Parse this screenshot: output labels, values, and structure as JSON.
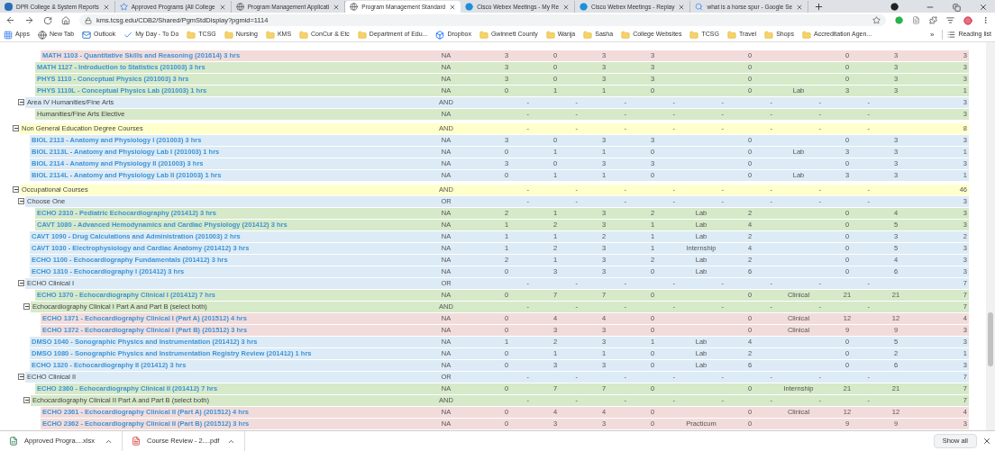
{
  "browser": {
    "tabs": [
      {
        "title": "DPR College & System Reports",
        "selected": false,
        "kind": "portal"
      },
      {
        "title": "Approved Programs (All College",
        "selected": false,
        "kind": "star"
      },
      {
        "title": "Program Management Applicati",
        "selected": false,
        "kind": "globe"
      },
      {
        "title": "Program Management Standard",
        "selected": true,
        "kind": "globe"
      },
      {
        "title": "Cisco Webex Meetings - My Re",
        "selected": false,
        "kind": "webex"
      },
      {
        "title": "Cisco Webex Meetings - Replay",
        "selected": false,
        "kind": "webex"
      },
      {
        "title": "what is a horse spur - Google Se",
        "selected": false,
        "kind": "search"
      }
    ],
    "address": "kms.tcsg.edu/CDB2/Shared/PgmStdDisplay?pgmid=1114",
    "bookmarks": [
      {
        "label": "Apps",
        "kind": "apps"
      },
      {
        "label": "New Tab",
        "kind": "site"
      },
      {
        "label": "Outlook",
        "kind": "mail"
      },
      {
        "label": "My Day - To Do",
        "kind": "check"
      },
      {
        "label": "TCSG",
        "kind": "folder"
      },
      {
        "label": "Nursing",
        "kind": "folder"
      },
      {
        "label": "KMS",
        "kind": "folder"
      },
      {
        "label": "ConCur & Etc",
        "kind": "folder"
      },
      {
        "label": "Department of Edu...",
        "kind": "folder"
      },
      {
        "label": "Dropbox",
        "kind": "box"
      },
      {
        "label": "Gwinnett County",
        "kind": "folder"
      },
      {
        "label": "Wanja",
        "kind": "folder"
      },
      {
        "label": "Sasha",
        "kind": "folder"
      },
      {
        "label": "College Websites",
        "kind": "folder"
      },
      {
        "label": "TCSG",
        "kind": "folder"
      },
      {
        "label": "Travel",
        "kind": "folder"
      },
      {
        "label": "Shops",
        "kind": "folder"
      },
      {
        "label": "Accreditation Agen...",
        "kind": "folder"
      }
    ],
    "overflow": "»",
    "reading_list": "Reading list"
  },
  "outline": [
    {
      "children": [
        {
          "children": [
            {
              "children": [
                {
                  "kind": "course",
                  "title": "MATH 1103 - Quantitative Skills and Reasoning (201614) 3 hrs",
                  "operator": "NA",
                  "color": "#f2dcdb",
                  "cells": [
                    "3",
                    "0",
                    "3",
                    "3",
                    null,
                    "0",
                    null,
                    "0",
                    "3",
                    "3"
                  ]
                }
              ]
            },
            {
              "kind": "course",
              "title": "MATH 1127 - Introduction to Statistics (201003) 3 hrs",
              "operator": "NA",
              "color": "#d6e9c9",
              "cells": [
                "3",
                "0",
                "3",
                "3",
                null,
                "0",
                null,
                "0",
                "3",
                "3"
              ]
            },
            {
              "kind": "course",
              "title": "PHYS 1110 - Conceptual Physics (201003) 3 hrs",
              "operator": "NA",
              "color": "#d6e9c9",
              "cells": [
                "3",
                "0",
                "3",
                "3",
                null,
                "0",
                null,
                "0",
                "3",
                "3"
              ]
            },
            {
              "kind": "course",
              "title": "PHYS 1110L - Conceptual Physics Lab (201003) 1 hrs",
              "operator": "NA",
              "color": "#d6e9c9",
              "cells": [
                "0",
                "1",
                "1",
                "0",
                null,
                "0",
                "Lab",
                "3",
                "3",
                "1"
              ]
            }
          ]
        },
        {
          "kind": "group",
          "title": "Area IV Humanities/Fine Arts",
          "operator": "AND",
          "color": "#dcebf6",
          "expanded": true,
          "cells": [
            "-",
            "-",
            "-",
            "-",
            "-",
            "-",
            "-",
            "-",
            null,
            "3"
          ],
          "children": [
            {
              "kind": "elective",
              "title": "Humanities/Fine Arts Elective",
              "operator": "NA",
              "color": "#d6e9c9",
              "cells": [
                "-",
                "-",
                "-",
                "-",
                "-",
                "-",
                "-",
                "-",
                null,
                "3"
              ]
            }
          ]
        }
      ]
    },
    {
      "kind": "group",
      "title": "Non General Education Degree Courses",
      "operator": "AND",
      "color": "#ffffcc",
      "expanded": true,
      "cells": [
        "-",
        "-",
        "-",
        "-",
        "-",
        "-",
        "-",
        "-",
        null,
        "8"
      ],
      "children": [
        {
          "kind": "course",
          "title": "BIOL 2113 - Anatomy and Physiology I (201003) 3 hrs",
          "operator": "NA",
          "color": "#dcebf6",
          "cells": [
            "3",
            "0",
            "3",
            "3",
            null,
            "0",
            null,
            "0",
            "3",
            "3"
          ]
        },
        {
          "kind": "course",
          "title": "BIOL 2113L - Anatomy and Physiology Lab I (201003) 1 hrs",
          "operator": "NA",
          "color": "#dcebf6",
          "cells": [
            "0",
            "1",
            "1",
            "0",
            null,
            "0",
            "Lab",
            "3",
            "3",
            "1"
          ]
        },
        {
          "kind": "course",
          "title": "BIOL 2114 - Anatomy and Physiology II (201003) 3 hrs",
          "operator": "NA",
          "color": "#dcebf6",
          "cells": [
            "3",
            "0",
            "3",
            "3",
            null,
            "0",
            null,
            "0",
            "3",
            "3"
          ]
        },
        {
          "kind": "course",
          "title": "BIOL 2114L - Anatomy and Physiology Lab II (201003) 1 hrs",
          "operator": "NA",
          "color": "#dcebf6",
          "cells": [
            "0",
            "1",
            "1",
            "0",
            null,
            "0",
            "Lab",
            "3",
            "3",
            "1"
          ]
        }
      ]
    },
    {
      "kind": "group",
      "title": "Occupational Courses",
      "operator": "AND",
      "color": "#ffffcc",
      "expanded": true,
      "cells": [
        "-",
        "-",
        "-",
        "-",
        "-",
        "-",
        "-",
        "-",
        null,
        "46"
      ],
      "children": [
        {
          "kind": "group",
          "title": "Choose One",
          "operator": "OR",
          "color": "#dcebf6",
          "expanded": true,
          "cells": [
            "-",
            "-",
            "-",
            "-",
            "-",
            "-",
            "-",
            "-",
            null,
            "3"
          ],
          "children": [
            {
              "kind": "course",
              "title": "ECHO 2310 - Pediatric Echocardiography (201412) 3 hrs",
              "operator": "NA",
              "color": "#d6e9c9",
              "cells": [
                "2",
                "1",
                "3",
                "2",
                "Lab",
                "2",
                null,
                "0",
                "4",
                "3"
              ]
            },
            {
              "kind": "course",
              "title": "CAVT 1080 - Advanced Hemodynamics and Cardiac Physiology (201412) 3 hrs",
              "operator": "NA",
              "color": "#d6e9c9",
              "cells": [
                "1",
                "2",
                "3",
                "1",
                "Lab",
                "4",
                null,
                "0",
                "5",
                "3"
              ]
            }
          ]
        },
        {
          "kind": "course",
          "title": "CAVT 1090 - Drug Calculations and Administration (201003) 2 hrs",
          "operator": "NA",
          "color": "#dcebf6",
          "cells": [
            "1",
            "1",
            "2",
            "1",
            "Lab",
            "2",
            null,
            "0",
            "3",
            "2"
          ]
        },
        {
          "kind": "course",
          "title": "CAVT 1030 - Electrophysiology and Cardiac Anatomy (201412) 3 hrs",
          "operator": "NA",
          "color": "#dcebf6",
          "cells": [
            "1",
            "2",
            "3",
            "1",
            "Internship",
            "4",
            null,
            "0",
            "5",
            "3"
          ]
        },
        {
          "kind": "course",
          "title": "ECHO 1100 - Echocardiography Fundamentals (201412) 3 hrs",
          "operator": "NA",
          "color": "#dcebf6",
          "cells": [
            "2",
            "1",
            "3",
            "2",
            "Lab",
            "2",
            null,
            "0",
            "4",
            "3"
          ]
        },
        {
          "kind": "course",
          "title": "ECHO 1310 - Echocardiography I (201412) 3 hrs",
          "operator": "NA",
          "color": "#dcebf6",
          "cells": [
            "0",
            "3",
            "3",
            "0",
            "Lab",
            "6",
            null,
            "0",
            "6",
            "3"
          ]
        },
        {
          "kind": "group",
          "title": "ECHO Clinical I",
          "operator": "OR",
          "color": "#dcebf6",
          "expanded": true,
          "cells": [
            "-",
            "-",
            "-",
            "-",
            "-",
            "-",
            "-",
            "-",
            null,
            "7"
          ],
          "children": [
            {
              "kind": "course",
              "title": "ECHO 1370 - Echocardiography Clinical I (201412) 7 hrs",
              "operator": "NA",
              "color": "#d6e9c9",
              "cells": [
                "0",
                "7",
                "7",
                "0",
                null,
                "0",
                "Clinical",
                "21",
                "21",
                "7"
              ]
            },
            {
              "kind": "group",
              "title": "Echocardiography Clinical I Part A and Part B (select both)",
              "operator": "AND",
              "color": "#d6e9c9",
              "expanded": true,
              "cells": [
                "-",
                "-",
                "-",
                "-",
                "-",
                "-",
                "-",
                "-",
                null,
                "7"
              ],
              "children": [
                {
                  "kind": "course",
                  "title": "ECHO 1371 - Echocardiography Clinical I (Part A) (201512) 4 hrs",
                  "operator": "NA",
                  "color": "#f2dcdb",
                  "cells": [
                    "0",
                    "4",
                    "4",
                    "0",
                    null,
                    "0",
                    "Clinical",
                    "12",
                    "12",
                    "4"
                  ]
                },
                {
                  "kind": "course",
                  "title": "ECHO 1372 - Echocardiography Clinical I (Part B) (201512) 3 hrs",
                  "operator": "NA",
                  "color": "#f2dcdb",
                  "cells": [
                    "0",
                    "3",
                    "3",
                    "0",
                    null,
                    "0",
                    "Clinical",
                    "9",
                    "9",
                    "3"
                  ]
                }
              ]
            }
          ]
        },
        {
          "kind": "course",
          "title": "DMSO 1040 - Sonographic Physics and Instrumentation (201412) 3 hrs",
          "operator": "NA",
          "color": "#dcebf6",
          "cells": [
            "1",
            "2",
            "3",
            "1",
            "Lab",
            "4",
            null,
            "0",
            "5",
            "3"
          ]
        },
        {
          "kind": "course",
          "title": "DMSO 1080 - Sonographic Physics and Instrumentation Registry Review (201412) 1 hrs",
          "operator": "NA",
          "color": "#dcebf6",
          "cells": [
            "0",
            "1",
            "1",
            "0",
            "Lab",
            "2",
            null,
            "0",
            "2",
            "1"
          ]
        },
        {
          "kind": "course",
          "title": "ECHO 1320 - Echocardiography II (201412) 3 hrs",
          "operator": "NA",
          "color": "#dcebf6",
          "cells": [
            "0",
            "3",
            "3",
            "0",
            "Lab",
            "6",
            null,
            "0",
            "6",
            "3"
          ]
        },
        {
          "kind": "group",
          "title": "ECHO Clinical II",
          "operator": "OR",
          "color": "#dcebf6",
          "expanded": true,
          "cells": [
            "-",
            "-",
            "-",
            "-",
            "-",
            "-",
            "-",
            "-",
            null,
            "7"
          ],
          "children": [
            {
              "kind": "course",
              "title": "ECHO 2360 - Echocardiography Clinical II (201412) 7 hrs",
              "operator": "NA",
              "color": "#d6e9c9",
              "cells": [
                "0",
                "7",
                "7",
                "0",
                null,
                "0",
                "Internship",
                "21",
                "21",
                "7"
              ]
            },
            {
              "kind": "group",
              "title": "Echocardiography Clinical II Part A and Part B (select both)",
              "operator": "AND",
              "color": "#d6e9c9",
              "expanded": true,
              "cells": [
                "-",
                "-",
                "-",
                "-",
                "-",
                "-",
                "-",
                "-",
                null,
                "7"
              ],
              "children": [
                {
                  "kind": "course",
                  "title": "ECHO 2361 - Echocardiography Clinical II (Part A) (201512) 4 hrs",
                  "operator": "NA",
                  "color": "#f2dcdb",
                  "cells": [
                    "0",
                    "4",
                    "4",
                    "0",
                    null,
                    "0",
                    "Clinical",
                    "12",
                    "12",
                    "4"
                  ]
                },
                {
                  "kind": "course",
                  "title": "ECHO 2362 - Echocardiography Clinical II (Part B) (201512) 3 hrs",
                  "operator": "NA",
                  "color": "#f2dcdb",
                  "cells": [
                    "0",
                    "3",
                    "3",
                    "0",
                    "Practicum",
                    "0",
                    null,
                    "9",
                    "9",
                    "3"
                  ]
                }
              ]
            }
          ]
        }
      ]
    }
  ],
  "downloads": {
    "items": [
      {
        "name": "Approved Progra....xlsx",
        "kind": "excel"
      },
      {
        "name": "Course Review - 2....pdf",
        "kind": "pdf"
      }
    ],
    "show_all": "Show all"
  }
}
